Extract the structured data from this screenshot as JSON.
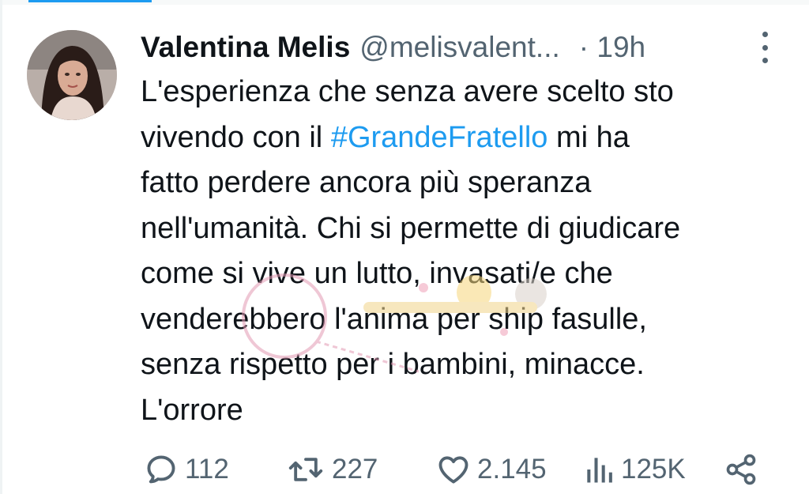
{
  "tweet": {
    "author_name": "Valentina Melis",
    "handle": "@melisvalent...",
    "time": "· 19h",
    "text_lines": [
      "L'esperienza che senza avere scelto sto",
      "vivendo con il ",
      "#GrandeFratello",
      " mi ha",
      "fatto perdere ancora più speranza",
      "nell'umanità. Chi si permette di giudicare",
      "come si vive un lutto, invasati/e che",
      "venderebbero l'anima per ship fasulle,",
      "senza rispetto per i bambini, minacce.",
      "L'orrore"
    ]
  },
  "stats": {
    "replies": "112",
    "retweets": "227",
    "likes": "2.145",
    "views": "125K"
  },
  "icons": {
    "reply": "reply-bubble-icon",
    "retweet": "retweet-icon",
    "like": "heart-icon",
    "views": "views-bar-chart-icon",
    "share": "share-icon",
    "more": "more-vertical-icon"
  },
  "colors": {
    "text": "#0f1419",
    "secondary": "#536471",
    "accent": "#1d9bf0"
  }
}
